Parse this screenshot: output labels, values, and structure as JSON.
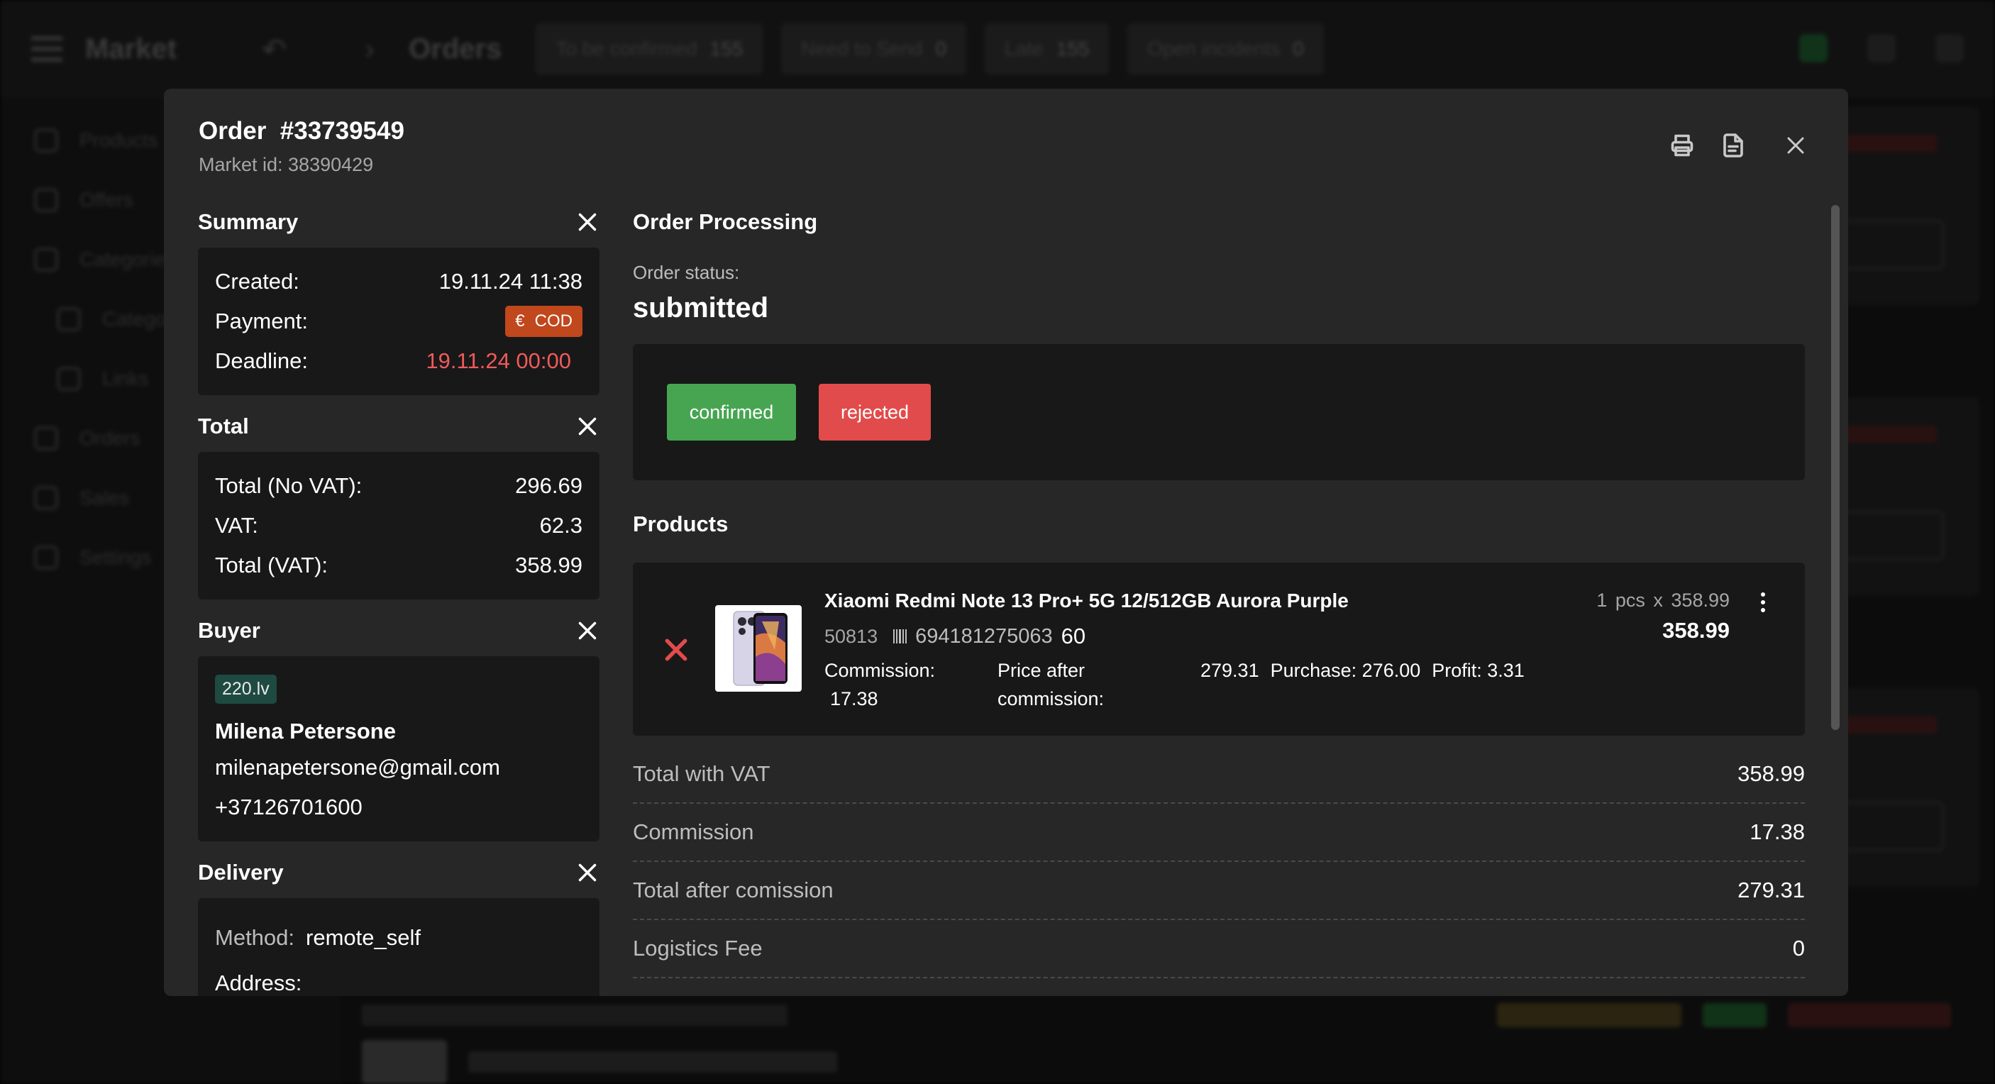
{
  "background": {
    "brand": "Market",
    "page_title": "Orders",
    "tabs": [
      {
        "label": "To be confirmed",
        "count": "155"
      },
      {
        "label": "Need to Send",
        "count": "0"
      },
      {
        "label": "Late",
        "count": "155"
      },
      {
        "label": "Open incidents",
        "count": "0"
      }
    ],
    "sidebar": [
      {
        "label": "Products"
      },
      {
        "label": "Offers"
      },
      {
        "label": "Categories"
      },
      {
        "label": "Categories"
      },
      {
        "label": "Links"
      },
      {
        "label": "Orders"
      },
      {
        "label": "Sales"
      },
      {
        "label": "Settings"
      }
    ]
  },
  "order": {
    "title": "Order  #33739549",
    "market_id": "Market id: 38390429"
  },
  "header_icons": [
    "printer-icon",
    "document-icon",
    "close-icon"
  ],
  "summary": {
    "title": "Summary",
    "created_label": "Created:",
    "created_value": "19.11.24 11:38",
    "payment_label": "Payment:",
    "payment_currency_icon": "€",
    "payment_value": "COD",
    "deadline_label": "Deadline:",
    "deadline_value": "19.11.24 00:00"
  },
  "total": {
    "title": "Total",
    "rows": [
      {
        "label": "Total (No VAT):",
        "value": "296.69"
      },
      {
        "label": "VAT:",
        "value": "62.3"
      },
      {
        "label": "Total (VAT):",
        "value": "358.99"
      }
    ]
  },
  "buyer": {
    "title": "Buyer",
    "site": "220.lv",
    "name": "Milena Petersone",
    "email": "milenapetersone@gmail.com",
    "phone": "+37126701600"
  },
  "delivery": {
    "title": "Delivery",
    "method_label": "Method:",
    "method_value": "remote_self",
    "address_label": "Address:"
  },
  "processing": {
    "title": "Order Processing",
    "status_label": "Order status:",
    "status_value": "submitted",
    "confirm_label": "confirmed",
    "reject_label": "rejected"
  },
  "products": {
    "title": "Products",
    "items": [
      {
        "name": "Xiaomi Redmi Note 13 Pro+ 5G 12/512GB Aurora Purple",
        "sku": "50813",
        "ean": "694181275063",
        "ean_last": "60",
        "commission_label": "Commission:",
        "commission_value": "17.38",
        "price_after_commission_label": "Price after commission:",
        "price_after_commission_value": "279.31",
        "purchase": "Purchase: 276.00",
        "profit": "Profit: 3.31",
        "qty": "1  pcs  x  358.99",
        "price": "358.99"
      }
    ]
  },
  "totals": [
    {
      "label": "Total with VAT",
      "value": "358.99"
    },
    {
      "label": "Commission",
      "value": "17.38"
    },
    {
      "label": "Total after comission",
      "value": "279.31"
    },
    {
      "label": "Logistics Fee",
      "value": "0"
    }
  ],
  "colors": {
    "modal_bg": "#272727",
    "card_bg": "#181818",
    "confirm": "#47a552",
    "reject": "#e24b4b",
    "cod_badge": "#c1471c",
    "deadline": "#f05a5a",
    "site_badge": "#1e4a42"
  }
}
